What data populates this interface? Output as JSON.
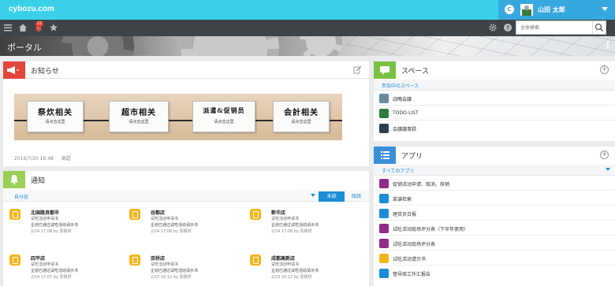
{
  "app": {
    "logo": "cybozu.com"
  },
  "user": {
    "initial": "C",
    "name": "山田 太郎",
    "notification_count": "22"
  },
  "search": {
    "placeholder": "全体検索"
  },
  "banner": {
    "title": "ポータル"
  },
  "announcement": {
    "title": "お知らせ",
    "plaques": [
      {
        "main": "祭炊相关",
        "sub": "请点击这里"
      },
      {
        "main": "超市相关",
        "sub": "请点击这里"
      },
      {
        "main": "派遣&促销员",
        "sub": "请点击这里"
      },
      {
        "main": "会計相关",
        "sub": "请点击这里"
      }
    ],
    "date": "2016/7/20 16:48",
    "author": "高超"
  },
  "notifications": {
    "title": "通知",
    "filter": "自分宛",
    "unread_label": "未読",
    "read_label": "既読",
    "items": [
      {
        "title": "北国路良都市",
        "sub": "试吃活动申请书",
        "line": "企划已通过试吃活动请示书",
        "time": "2/24 17:08  by 贾颖妍"
      },
      {
        "title": "谷都店",
        "sub": "试吃活动申请书",
        "line": "企划已通过试吃活动请示书",
        "time": "2/24 17:08  by 贾颖妍"
      },
      {
        "title": "新华店",
        "sub": "试吃活动申请书",
        "line": "企划已通过试吃活动请示书",
        "time": "2/24 17:08  by 贾颖妍"
      },
      {
        "title": "四平店",
        "sub": "试吃活动申请书",
        "line": "企划已通过试吃活动请示书",
        "time": "2/24 17:07  by 贾颖妍"
      },
      {
        "title": "双桥店",
        "sub": "试吃活动申请书",
        "line": "企划已通过试吃活动请示书",
        "time": "2/23 10:12  by 贾颖妍"
      },
      {
        "title": "成都高新店",
        "sub": "试吃活动申请书",
        "line": "企划已通过试吃活动请示书",
        "time": "2/23 10:12  by 贾颖妍"
      }
    ]
  },
  "spaces": {
    "title": "スペース",
    "section": "参加中のスペース",
    "items": [
      {
        "label": "战略会議",
        "color": "#6a8c9a"
      },
      {
        "label": "TODO-LIST",
        "color": "#2f7d3a"
      },
      {
        "label": "会議議事録",
        "color": "#2c3e50"
      }
    ]
  },
  "apps": {
    "title": "アプリ",
    "section": "すべてのアプリ",
    "items": [
      {
        "label": "促销活动申请、取消、核销",
        "color": "#8e2d8a"
      },
      {
        "label": "菜谱检索",
        "color": "#1a8cd8"
      },
      {
        "label": "理货员日报",
        "color": "#1a8cd8"
      },
      {
        "label": "试吃活动现场评分表（下半年使用）",
        "color": "#8e2d8a"
      },
      {
        "label": "试吃活动现场评分表",
        "color": "#8e2d8a"
      },
      {
        "label": "试吃活动请示书",
        "color": "#f4b51a"
      },
      {
        "label": "督导周工作汇报告",
        "color": "#1a8cd8"
      }
    ]
  },
  "colors": {
    "accent": "#3ad0ea",
    "toolbar": "#3e4448",
    "link": "#1a8cd8"
  }
}
